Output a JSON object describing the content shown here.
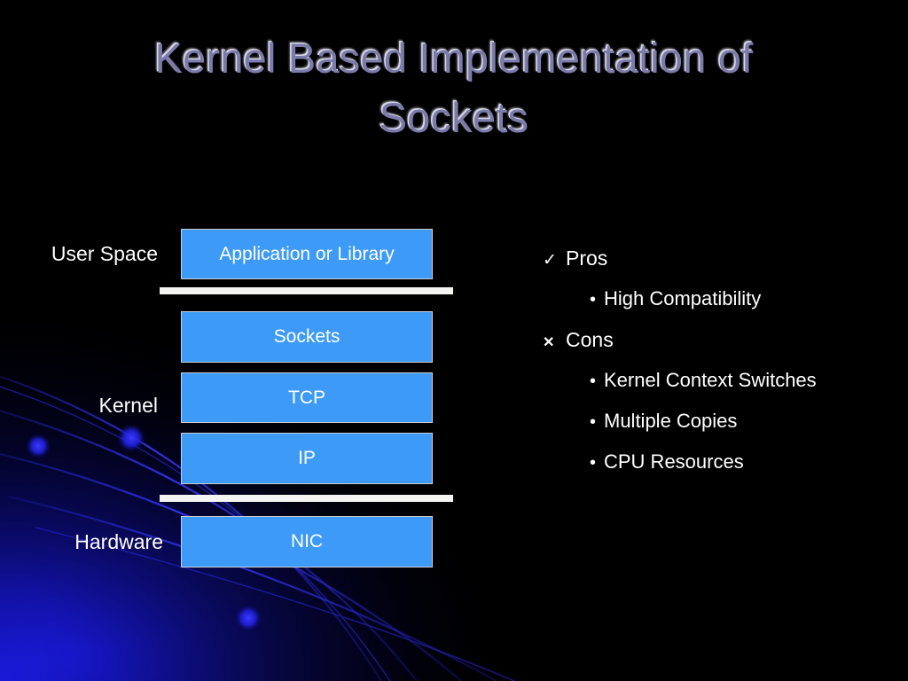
{
  "slide": {
    "title": "Kernel Based Implementation of\nSockets",
    "background_color": "#000000",
    "title_color": "#7b7bab",
    "accent_box_color": "#3d9bf7",
    "divider_color": "#f4f4f2",
    "glow_color": "#0c12c8"
  },
  "diagram": {
    "zone_labels": [
      {
        "id": "user-space",
        "text": "User Space"
      },
      {
        "id": "kernel",
        "text": "Kernel"
      },
      {
        "id": "hardware",
        "text": "Hardware"
      }
    ],
    "boxes": [
      {
        "id": "app",
        "text": "Application or Library",
        "zone": "user-space"
      },
      {
        "id": "sockets",
        "text": "Sockets",
        "zone": "kernel"
      },
      {
        "id": "tcp",
        "text": "TCP",
        "zone": "kernel"
      },
      {
        "id": "ip",
        "text": "IP",
        "zone": "kernel"
      },
      {
        "id": "nic",
        "text": "NIC",
        "zone": "hardware"
      }
    ],
    "dividers": [
      {
        "id": "user-kernel",
        "label": ""
      },
      {
        "id": "kernel-hardware",
        "label": ""
      }
    ]
  },
  "bullets": {
    "pros": {
      "marker": "✓",
      "marker_name": "check-icon",
      "label": "Pros",
      "items": [
        {
          "marker": "•",
          "text": "High Compatibility"
        }
      ]
    },
    "cons": {
      "marker": "✕",
      "marker_name": "cross-icon",
      "label": "Cons",
      "items": [
        {
          "marker": "•",
          "text": "Kernel Context Switches"
        },
        {
          "marker": "•",
          "text": "Multiple Copies"
        },
        {
          "marker": "•",
          "text": "CPU Resources"
        }
      ]
    }
  }
}
